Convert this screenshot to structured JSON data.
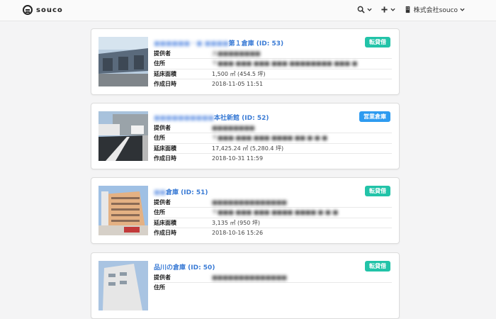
{
  "brand": {
    "name": "souco"
  },
  "nav": {
    "company": "株式会社souco"
  },
  "labels": {
    "provider": "提供者",
    "address": "住所",
    "area": "延床面積",
    "created": "作成日時"
  },
  "cards": [
    {
      "title_hidden": "■■■■■■・■ ■■■■",
      "title_visible": "第１倉庫 (ID: 53)",
      "badge": "転貸借",
      "badge_color": "#22c3a8",
      "provider": "大■■■■■■■■",
      "address": "〒■■■-■■■ ■■■ ■■■ ■■■■■■■■ ■■■-■",
      "area": "1,500 ㎡ (454.5 坪)",
      "created": "2018-11-05 11:51"
    },
    {
      "title_hidden": "■■■■■■■■■■",
      "title_visible": "本社新館 (ID: 52)",
      "badge": "営業倉庫",
      "badge_color": "#2e9bf0",
      "provider": "■■■■■■■■",
      "address": "〒■■■-■■■ ■■■ ■■■■ ■■ ■-■-■",
      "area": "17,425.24 ㎡ (5,280.4 坪)",
      "created": "2018-10-31 11:59"
    },
    {
      "title_hidden": "■■",
      "title_visible": "倉庫 (ID: 51)",
      "badge": "転貸借",
      "badge_color": "#22c3a8",
      "provider": "■■■■■■■■■■■■■■",
      "address": "〒■■■-■■■ ■■■ ■■■■ ■■■■ ■-■-■",
      "area": "3,135 ㎡ (950 坪)",
      "created": "2018-10-16 15:26"
    },
    {
      "title_hidden": "",
      "title_visible": "品川の倉庫 (ID: 50)",
      "badge": "転貸借",
      "badge_color": "#22c3a8",
      "provider": "■■■■■■■■■■■■■■",
      "address": "",
      "area": "",
      "created": ""
    }
  ]
}
